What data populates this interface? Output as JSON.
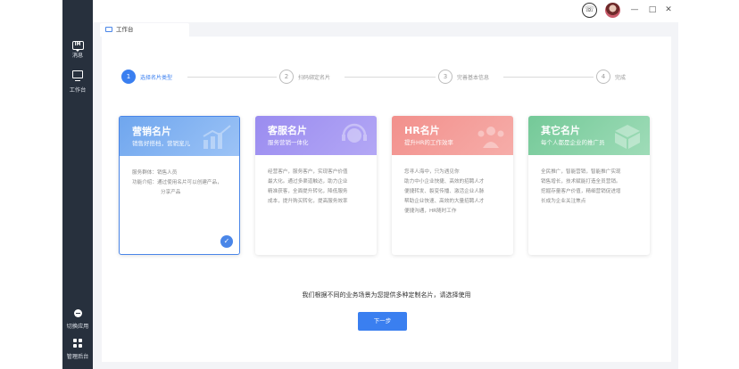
{
  "sidebar": {
    "items": [
      {
        "label": "消息",
        "icon": "im-message-icon"
      },
      {
        "label": "工作台",
        "icon": "workbench-monitor-icon"
      },
      {
        "label": "切换应用",
        "icon": "switch-app-icon"
      },
      {
        "label": "管理后台",
        "icon": "admin-grid-icon"
      }
    ],
    "im_badge": "IM"
  },
  "topbar": {
    "phone_icon": "☏",
    "minimize": "—",
    "maximize": "□",
    "close": "✕"
  },
  "tab": {
    "label": "工作台"
  },
  "steps": [
    {
      "number": "1",
      "label": "选择名片类型",
      "active": true
    },
    {
      "number": "2",
      "label": "扫码绑定名片",
      "active": false
    },
    {
      "number": "3",
      "label": "完善基本信息",
      "active": false
    },
    {
      "number": "4",
      "label": "完成",
      "active": false
    }
  ],
  "cards": [
    {
      "title": "营销名片",
      "subtitle": "销售好搭档，营销宠儿",
      "color": "#7fb0f0",
      "selected": true,
      "lines": [
        "服务群体：销售人员",
        "功能介绍：通过使用名片可以创建产品，",
        "分享产品"
      ]
    },
    {
      "title": "客服名片",
      "subtitle": "服务营销一体化",
      "color": "#9f8ff0",
      "selected": false,
      "lines": [
        "经营客户，服务客户，实现客户价值",
        "最大化。通过多渠道触达，助力企业",
        "精准获客，全面提升转化，降低服务",
        "成本，提升购买转化，提高服务效率"
      ]
    },
    {
      "title": "HR名片",
      "subtitle": "提升HR的工作效率",
      "color": "#f39a96",
      "selected": false,
      "lines": [
        "您寻人海中，只为遇见你",
        "助力中小企业快捷、高效的招聘人才",
        "便捷转发、裂变传播、激活企业人脉",
        "帮助企业快速、高效的大量招聘人才",
        "便捷沟通，HR随时工作"
      ]
    },
    {
      "title": "其它名片",
      "subtitle": "每个人都是企业的推广员",
      "color": "#7fd0a0",
      "selected": false,
      "lines": [
        "全民推广，智能营销，智能推广实现",
        "销售增长，技术赋能打造全员营销。",
        "挖掘存量客户价值，精细营销促进增",
        "长成为企业关注焦点"
      ]
    }
  ],
  "hint": "我们根据不同的业务场景为您提供多种定制名片，请选择使用",
  "next_button": "下一步",
  "check_mark": "✓"
}
